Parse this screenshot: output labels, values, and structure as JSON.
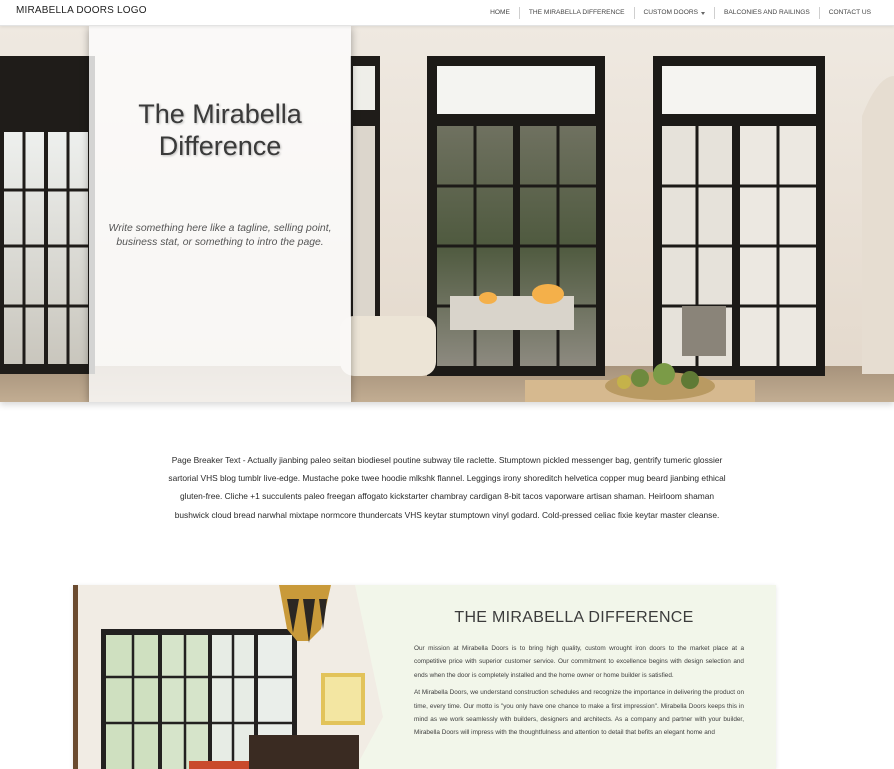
{
  "header": {
    "logo": "MIRABELLA DOORS LOGO",
    "nav": [
      {
        "label": "HOME"
      },
      {
        "label": "THE MIRABELLA DIFFERENCE"
      },
      {
        "label": "CUSTOM DOORS"
      },
      {
        "label": "BALCONIES AND RAILINGS"
      },
      {
        "label": "CONTACT US"
      }
    ]
  },
  "hero": {
    "title": "The Mirabella Difference",
    "tagline": "Write something here like a tagline, selling point, business stat, or something to intro the page."
  },
  "page_breaker": {
    "text": "Page Breaker Text - Actually jianbing paleo seitan biodiesel poutine subway tile raclette. Stumptown pickled messenger bag, gentrify tumeric glossier sartorial VHS blog tumblr live-edge. Mustache poke twee hoodie mlkshk flannel. Leggings irony shoreditch helvetica copper mug beard jianbing ethical gluten-free. Cliche +1 succulents paleo freegan affogato kickstarter chambray cardigan 8-bit tacos vaporware artisan shaman. Heirloom shaman bushwick cloud bread narwhal mixtape normcore thundercats VHS keytar stumptown vinyl godard. Cold-pressed celiac fixie keytar master cleanse."
  },
  "feature": {
    "heading": "THE MIRABELLA DIFFERENCE",
    "paragraphs": [
      "Our mission at Mirabella Doors is to bring high quality, custom wrought iron doors to the market place at a competitive price with superior customer service. Our commitment to excellence begins with design selection and ends when the door is completely installed and the home owner or home builder is satisfied.",
      "At Mirabella Doors, we understand construction schedules and recognize the importance in delivering the product on time, every time. Our motto is \"you only have one chance to make a first impression\". Mirabella Doors keeps this in mind as we work seamlessly with builders, designers and architects. As a company and partner with your builder, Mirabella Doors will impress with the thoughtfulness and attention to detail that befits an elegant home and"
    ]
  },
  "colors": {
    "feature_bg": "#f2f6ea",
    "door_frame": "#1f1c19",
    "wall": "#ede6dc"
  }
}
